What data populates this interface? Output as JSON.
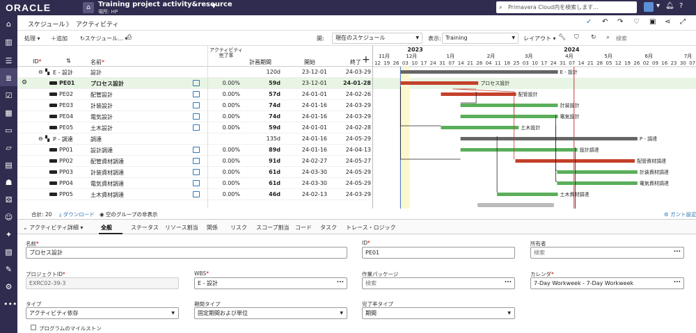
{
  "header": {
    "logo": "ORACLE",
    "project_title": "Training project activity&resource",
    "project_location": "場所: HP",
    "search_placeholder": "Primavera Cloud内を検索します..."
  },
  "breadcrumb": {
    "schedule": "スケジュール",
    "sep": "〉",
    "current": "アクティビティ"
  },
  "toolbar": {
    "actions": "処理",
    "add": "追加",
    "schedule": "スケジュール...",
    "open_label": "開:",
    "open_value": "現在のスケジュール",
    "view_label": "表示:",
    "view_value": "Training",
    "layout": "レイアウト",
    "search": "検索"
  },
  "grid": {
    "headers": {
      "id": "ID",
      "name": "名前",
      "pct": "アクティビティ完了率",
      "planned": "計画期間",
      "start": "開始",
      "finish": "終了"
    },
    "rows": [
      {
        "indent": 1,
        "group": true,
        "id": "E - 設計",
        "name": "設計",
        "pct": "",
        "planned": "120d",
        "start": "23-12-01",
        "finish": "24-03-29"
      },
      {
        "indent": 2,
        "group": false,
        "id": "PE01",
        "name": "プロセス設計",
        "pct": "0.00%",
        "planned": "59d",
        "start": "23-12-01",
        "finish": "24-01-28",
        "selected": true
      },
      {
        "indent": 2,
        "group": false,
        "id": "PE02",
        "name": "配管設計",
        "pct": "0.00%",
        "planned": "57d",
        "start": "24-01-01",
        "finish": "24-02-26"
      },
      {
        "indent": 2,
        "group": false,
        "id": "PE03",
        "name": "計装設計",
        "pct": "0.00%",
        "planned": "74d",
        "start": "24-01-16",
        "finish": "24-03-29"
      },
      {
        "indent": 2,
        "group": false,
        "id": "PE04",
        "name": "電気設計",
        "pct": "0.00%",
        "planned": "74d",
        "start": "24-01-16",
        "finish": "24-03-29"
      },
      {
        "indent": 2,
        "group": false,
        "id": "PE05",
        "name": "土木設計",
        "pct": "0.00%",
        "planned": "59d",
        "start": "24-01-01",
        "finish": "24-02-28"
      },
      {
        "indent": 1,
        "group": true,
        "id": "P - 調達",
        "name": "調達",
        "pct": "",
        "planned": "135d",
        "start": "24-01-16",
        "finish": "24-05-29"
      },
      {
        "indent": 2,
        "group": false,
        "id": "PP01",
        "name": "設計調達",
        "pct": "0.00%",
        "planned": "89d",
        "start": "24-01-16",
        "finish": "24-04-13"
      },
      {
        "indent": 2,
        "group": false,
        "id": "PP02",
        "name": "配管資材調達",
        "pct": "0.00%",
        "planned": "91d",
        "start": "24-02-27",
        "finish": "24-05-27"
      },
      {
        "indent": 2,
        "group": false,
        "id": "PP03",
        "name": "計装資材調達",
        "pct": "0.00%",
        "planned": "61d",
        "start": "24-03-30",
        "finish": "24-05-29"
      },
      {
        "indent": 2,
        "group": false,
        "id": "PP04",
        "name": "電気資材調達",
        "pct": "0.00%",
        "planned": "61d",
        "start": "24-03-30",
        "finish": "24-05-29"
      },
      {
        "indent": 2,
        "group": false,
        "id": "PP05",
        "name": "土木資材調達",
        "pct": "0.00%",
        "planned": "46d",
        "start": "24-02-13",
        "finish": "24-03-29"
      }
    ]
  },
  "gantt": {
    "years": [
      "2023",
      "2024"
    ],
    "months": [
      "11月",
      "12月",
      "1月",
      "2月",
      "3月",
      "4月",
      "5月",
      "6月",
      "7月"
    ],
    "weeks": [
      "12",
      "19",
      "26",
      "03",
      "10",
      "17",
      "24",
      "31",
      "07",
      "14",
      "21",
      "28",
      "04",
      "11",
      "18",
      "25",
      "03",
      "10",
      "17",
      "24",
      "31",
      "07",
      "14",
      "21",
      "28",
      "05",
      "12",
      "19",
      "26",
      "02",
      "09",
      "16",
      "23",
      "30",
      "07"
    ],
    "bar_labels": [
      "E - 設計",
      "プロセス設計",
      "配管設計",
      "計装設計",
      "電気設計",
      "土木設計",
      "P - 調達",
      "設計調達",
      "配管資材調達",
      "計装資材調達",
      "電気資材調達",
      "土木資材調達"
    ],
    "colors": {
      "summary": "#666666",
      "critical": "#c4412b",
      "normal": "#5aae5a"
    },
    "settings": "ガント設定"
  },
  "footer": {
    "total": "合計: 20",
    "download": "ダウンロード",
    "hide_groups": "空のグループの非表示"
  },
  "detail": {
    "title": "アクティビティ詳細",
    "tabs": [
      "全般",
      "ステータス",
      "リソース割当",
      "関係",
      "リスク",
      "スコープ割当",
      "コード",
      "タスク",
      "トレース・ロジック"
    ],
    "fields": {
      "name_label": "名前",
      "name_value": "プロセス設計",
      "id_label": "ID",
      "id_value": "PE01",
      "owner_label": "所有者",
      "owner_placeholder": "検索",
      "projid_label": "プロジェクトID",
      "projid_value": "EXRC02-39-3",
      "wbs_label": "WBS",
      "wbs_value": "E - 設計",
      "workpkg_label": "作業パッケージ",
      "workpkg_placeholder": "検索",
      "calendar_label": "カレンダ",
      "calendar_value": "7-Day Workweek - 7-Day Workweek",
      "type_label": "タイプ",
      "type_value": "アクティビティ依存",
      "durtype_label": "期間タイプ",
      "durtype_value": "固定期間および単位",
      "pcttype_label": "完了率タイプ",
      "pcttype_value": "期間",
      "milestone_label": "プログラムのマイルストン"
    }
  }
}
